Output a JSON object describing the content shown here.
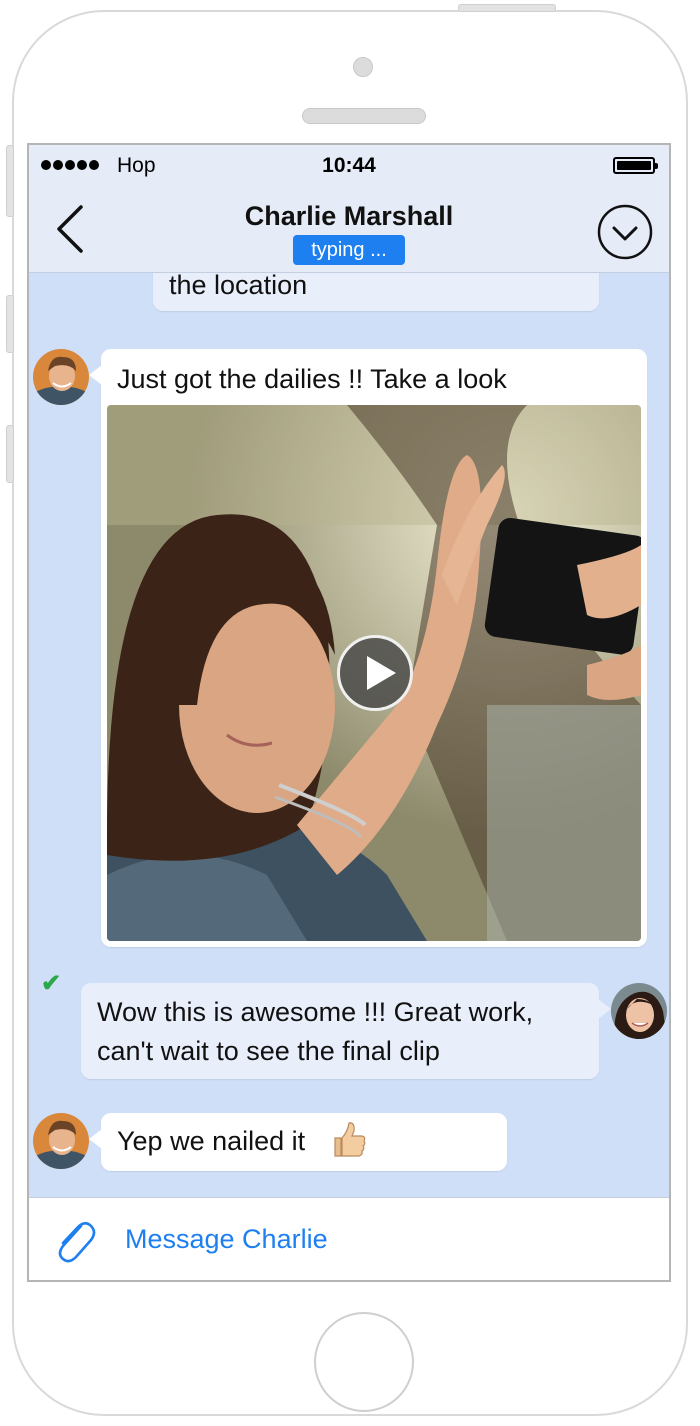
{
  "colors": {
    "accent": "#1d7ff0",
    "chat_background": "#cfdff7",
    "header_background": "#e5ecf8",
    "incoming_bubble": "#ffffff",
    "outgoing_bubble": "#e9eefb",
    "read_check": "#2ba84a"
  },
  "status_bar": {
    "carrier": "Hop",
    "time": "10:44",
    "signal_icon": "signal-dots-icon",
    "battery_icon": "battery-full-icon"
  },
  "header": {
    "back_icon": "chevron-left-icon",
    "title": "Charlie Marshall",
    "status": "typing ...",
    "menu_icon": "chevron-down-circle-icon"
  },
  "messages": [
    {
      "direction": "out",
      "text": "the location"
    },
    {
      "direction": "in",
      "text": "Just got the dailies !! Take a look",
      "attachment": "video",
      "play_icon": "play-icon"
    },
    {
      "direction": "out",
      "text_line1": "Wow this is awesome !!! Great work,",
      "text_line2": "can't wait to see the final clip",
      "status": "read",
      "status_icon": "checkmark-icon",
      "status_glyph": "✔"
    },
    {
      "direction": "in",
      "text": "Yep we nailed it",
      "emoji": "thumbs-up-icon"
    }
  ],
  "composer": {
    "attach_icon": "paperclip-icon",
    "placeholder": "Message Charlie"
  }
}
